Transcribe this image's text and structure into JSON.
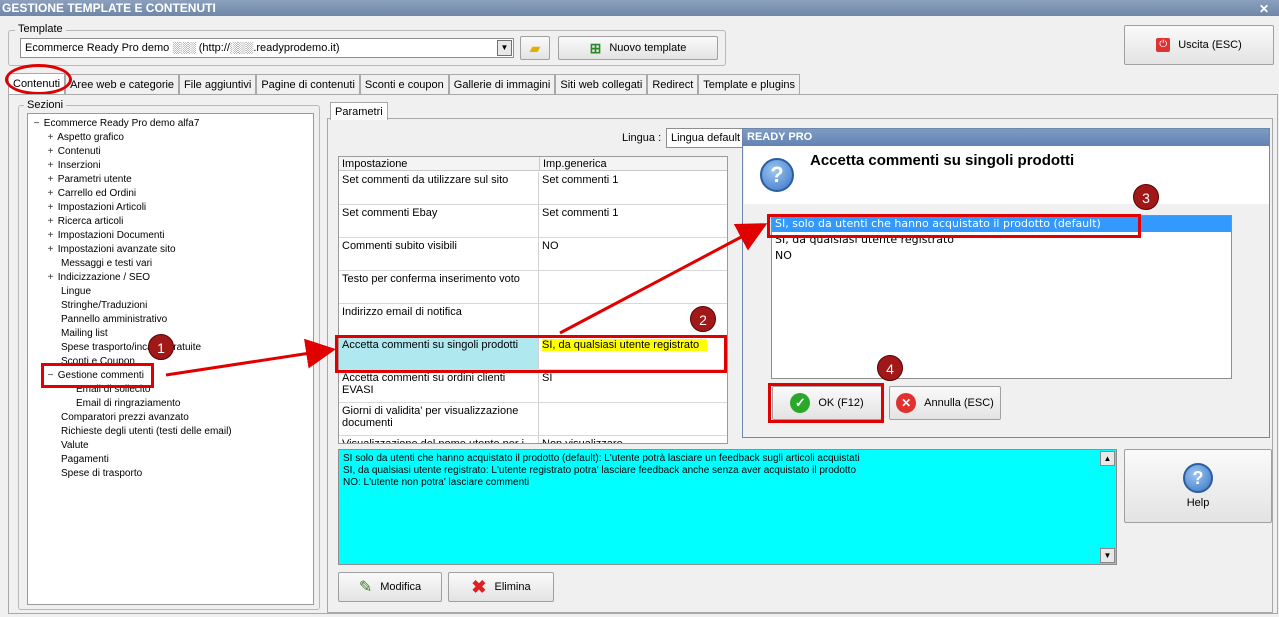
{
  "window": {
    "title": "GESTIONE TEMPLATE E CONTENUTI",
    "close": "✕"
  },
  "template": {
    "group_label": "Template",
    "selected": "Ecommerce Ready Pro demo ░░░ (http://░░░.readyprodemo.it)",
    "new_label": "Nuovo template"
  },
  "exit_label": "Uscita (ESC)",
  "tabs": [
    "Contenuti",
    "Aree web e categorie",
    "File aggiuntivi",
    "Pagine di contenuti",
    "Sconti e coupon",
    "Gallerie di immagini",
    "Siti web collegati",
    "Redirect",
    "Template e plugins"
  ],
  "sections": {
    "label": "Sezioni",
    "root": "Ecommerce Ready Pro demo alfa7",
    "items": [
      "Aspetto grafico",
      "Contenuti",
      "Inserzioni",
      "Parametri utente",
      "Carrello ed Ordini",
      "Impostazioni Articoli",
      "Ricerca articoli",
      "Impostazioni Documenti",
      "Impostazioni avanzate sito",
      "Messaggi e testi vari",
      "Indicizzazione / SEO",
      "Lingue",
      "Stringhe/Traduzioni",
      "Pannello amministrativo",
      "Mailing list",
      "Spese trasporto/incassi gratuite",
      "Sconti e Coupon",
      "Gestione commenti",
      "Email di sollecito",
      "Email di ringraziamento",
      "Comparatori prezzi avanzato",
      "Richieste degli utenti (testi delle email)",
      "Valute",
      "Pagamenti",
      "Spese di trasporto"
    ]
  },
  "params": {
    "tab": "Parametri",
    "lingua_label": "Lingua :",
    "lingua_value": "Lingua default",
    "col1": "Impostazione",
    "col2": "Imp.generica",
    "rows": [
      {
        "name": "Set commenti da utilizzare sul sito",
        "value": "Set commenti 1"
      },
      {
        "name": "Set commenti Ebay",
        "value": "Set commenti 1"
      },
      {
        "name": "Commenti subito visibili",
        "value": "NO"
      },
      {
        "name": "Testo per conferma inserimento voto",
        "value": ""
      },
      {
        "name": "Indirizzo email di notifica",
        "value": ""
      },
      {
        "name": "Accetta commenti su singoli prodotti",
        "value": "SI, da qualsiasi utente registrato"
      },
      {
        "name": "Accetta commenti su ordini clienti EVASI",
        "value": "SI"
      },
      {
        "name": "Giorni di validita' per visualizzazione documenti",
        "value": ""
      },
      {
        "name": "Visualizzazione del nome utente per i",
        "value": "Non visualizzare"
      }
    ]
  },
  "description": [
    "SI solo da utenti che hanno acquistato il prodotto (default): L'utente potrà lasciare un feedback sugli articoli acquistati",
    "SI, da qualsiasi utente registrato: L'utente registrato potra' lasciare feedback anche senza aver acquistato il prodotto",
    "NO: L'utente non potra' lasciare commenti"
  ],
  "buttons": {
    "modifica": "Modifica",
    "elimina": "Elimina",
    "help": "Help"
  },
  "dialog": {
    "title": "READY PRO",
    "heading": "Accetta commenti su singoli prodotti",
    "options": [
      "SI, solo da utenti che hanno acquistato il prodotto (default)",
      "SI, da qualsiasi utente registrato",
      "NO"
    ],
    "ok": "OK (F12)",
    "cancel": "Annulla (ESC)"
  },
  "badges": [
    "1",
    "2",
    "3",
    "4"
  ],
  "colors": {
    "highlight": "#ffff00",
    "selected_row": "#b0e8f0",
    "callout": "#e00000",
    "badge": "#a01818",
    "desc_bg": "#00ffff"
  }
}
